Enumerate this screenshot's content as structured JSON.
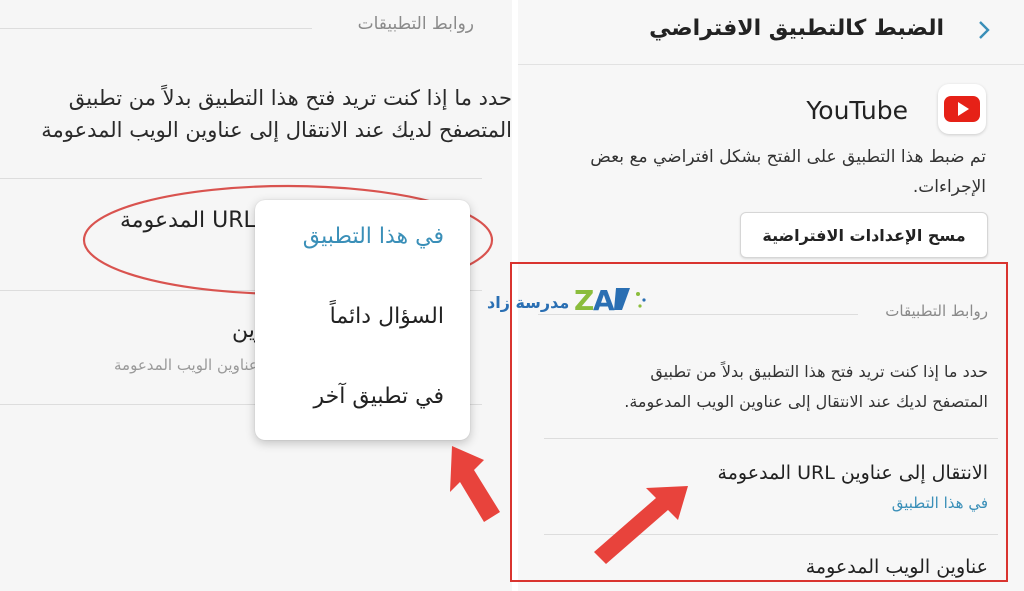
{
  "left": {
    "section_label": "روابط التطبيقات",
    "desc_line1": "حدد ما إذا كنت تريد فتح هذا التطبيق بدلاً من تطبيق",
    "desc_line2": "المتصفح لديك عند الانتقال إلى عناوين الويب المدعومة",
    "url_item_title": "URL المدعومة",
    "web_item_title": "عناوين",
    "web_item_sub": "عناوين الويب المدعومة"
  },
  "popup": {
    "options": [
      "في هذا التطبيق",
      "السؤال دائماً",
      "في تطبيق آخر"
    ],
    "selected_color": "#3a8fb8"
  },
  "right": {
    "header_title": "الضبط كالتطبيق الافتراضي",
    "app_name": "YouTube",
    "app_desc": "تم ضبط هذا التطبيق على الفتح بشكل افتراضي مع بعض الإجراءات.",
    "clear_button": "مسح الإعدادات الافتراضية",
    "section_label": "روابط التطبيقات",
    "desc_line1": "حدد ما إذا كنت تريد فتح هذا التطبيق بدلاً من تطبيق",
    "desc_line2": "المتصفح لديك عند الانتقال إلى عناوين الويب المدعومة.",
    "url_item_title": "الانتقال إلى عناوين URL المدعومة",
    "url_item_value": "في هذا التطبيق",
    "web_item_title": "عناوين الويب المدعومة"
  },
  "watermark": {
    "logo_text": "مدرسة زاد"
  },
  "colors": {
    "accent_blue": "#3a8fb8",
    "annotation_red": "#e2413b",
    "youtube_red": "#e62117"
  }
}
